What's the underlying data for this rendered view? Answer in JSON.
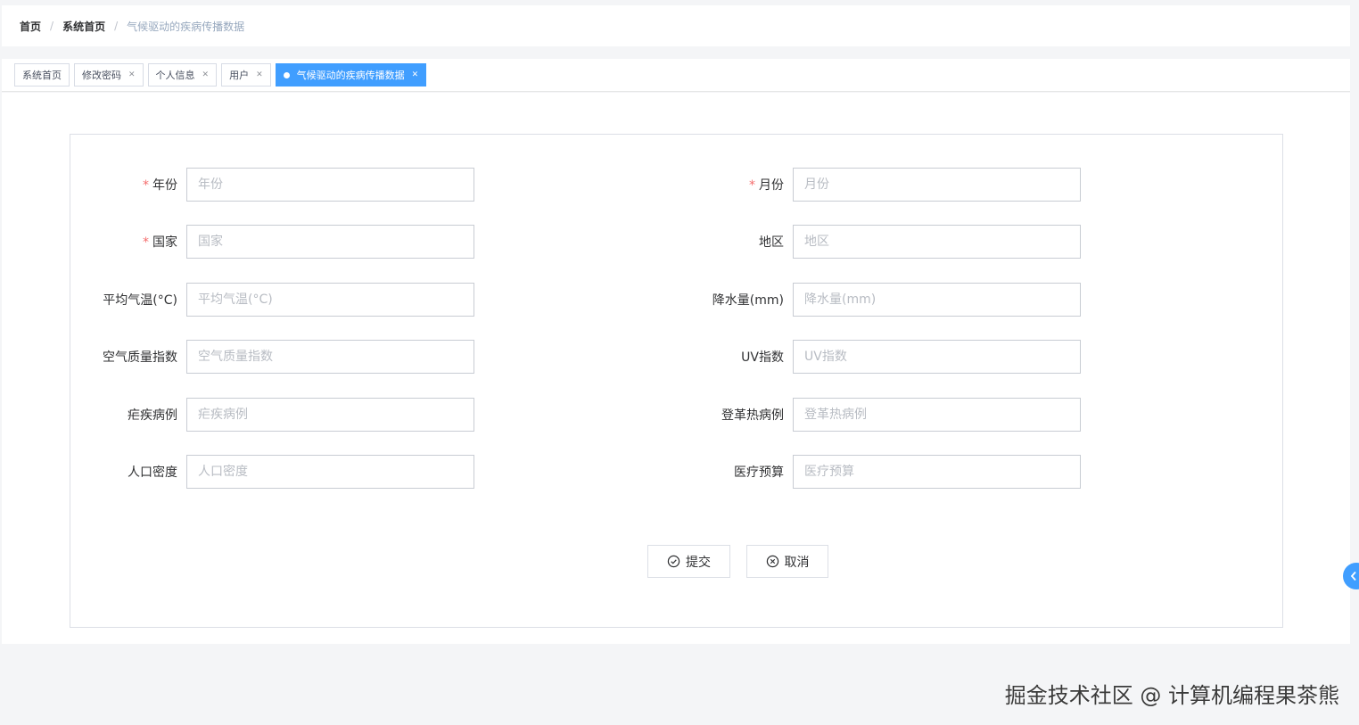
{
  "breadcrumb": {
    "items": [
      "首页",
      "系统首页",
      "气候驱动的疾病传播数据"
    ],
    "separator": "/"
  },
  "tags": [
    {
      "label": "系统首页",
      "closable": false,
      "active": false
    },
    {
      "label": "修改密码",
      "closable": true,
      "active": false
    },
    {
      "label": "个人信息",
      "closable": true,
      "active": false
    },
    {
      "label": "用户",
      "closable": true,
      "active": false
    },
    {
      "label": "气候驱动的疾病传播数据",
      "closable": true,
      "active": true
    }
  ],
  "form": {
    "fields": [
      {
        "label": "年份",
        "placeholder": "年份",
        "required": true
      },
      {
        "label": "月份",
        "placeholder": "月份",
        "required": true
      },
      {
        "label": "国家",
        "placeholder": "国家",
        "required": true
      },
      {
        "label": "地区",
        "placeholder": "地区",
        "required": false
      },
      {
        "label": "平均气温(°C)",
        "placeholder": "平均气温(°C)",
        "required": false
      },
      {
        "label": "降水量(mm)",
        "placeholder": "降水量(mm)",
        "required": false
      },
      {
        "label": "空气质量指数",
        "placeholder": "空气质量指数",
        "required": false
      },
      {
        "label": "UV指数",
        "placeholder": "UV指数",
        "required": false
      },
      {
        "label": "疟疾病例",
        "placeholder": "疟疾病例",
        "required": false
      },
      {
        "label": "登革热病例",
        "placeholder": "登革热病例",
        "required": false
      },
      {
        "label": "人口密度",
        "placeholder": "人口密度",
        "required": false
      },
      {
        "label": "医疗预算",
        "placeholder": "医疗预算",
        "required": false
      }
    ],
    "required_mark": "*",
    "submit_label": "提交",
    "cancel_label": "取消"
  },
  "watermark": "掘金技术社区 @ 计算机编程果茶熊",
  "colors": {
    "accent": "#409eff",
    "required": "#f56c6c",
    "border": "#dcdfe6"
  }
}
